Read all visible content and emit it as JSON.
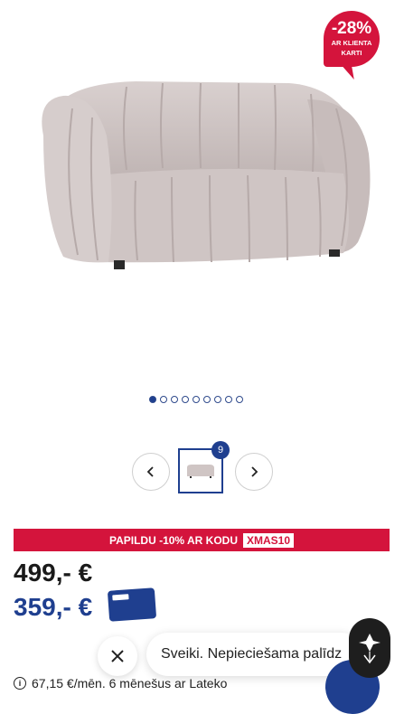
{
  "badge": {
    "percent": "-28%",
    "line1": "AR KLIENTA",
    "line2": "KARTI",
    "color": "#d4143c"
  },
  "gallery": {
    "dot_count": 9,
    "active_index": 0,
    "image_count": "9",
    "prev_icon": "chevron-left-icon",
    "next_icon": "chevron-right-icon"
  },
  "promo": {
    "text": "PAPILDU -10% AR KODU",
    "code": "XMAS10"
  },
  "price": {
    "regular": "499,-  €",
    "member": "359,- €"
  },
  "chat": {
    "message": "Sveiki. Nepieciešama palīdz",
    "close_icon": "close-icon"
  },
  "installment": {
    "text": "67,15  €/mēn. 6 mēnešus ar Lateko"
  },
  "colors": {
    "brand_blue": "#1f3f8f",
    "sale_red": "#d4143c"
  }
}
